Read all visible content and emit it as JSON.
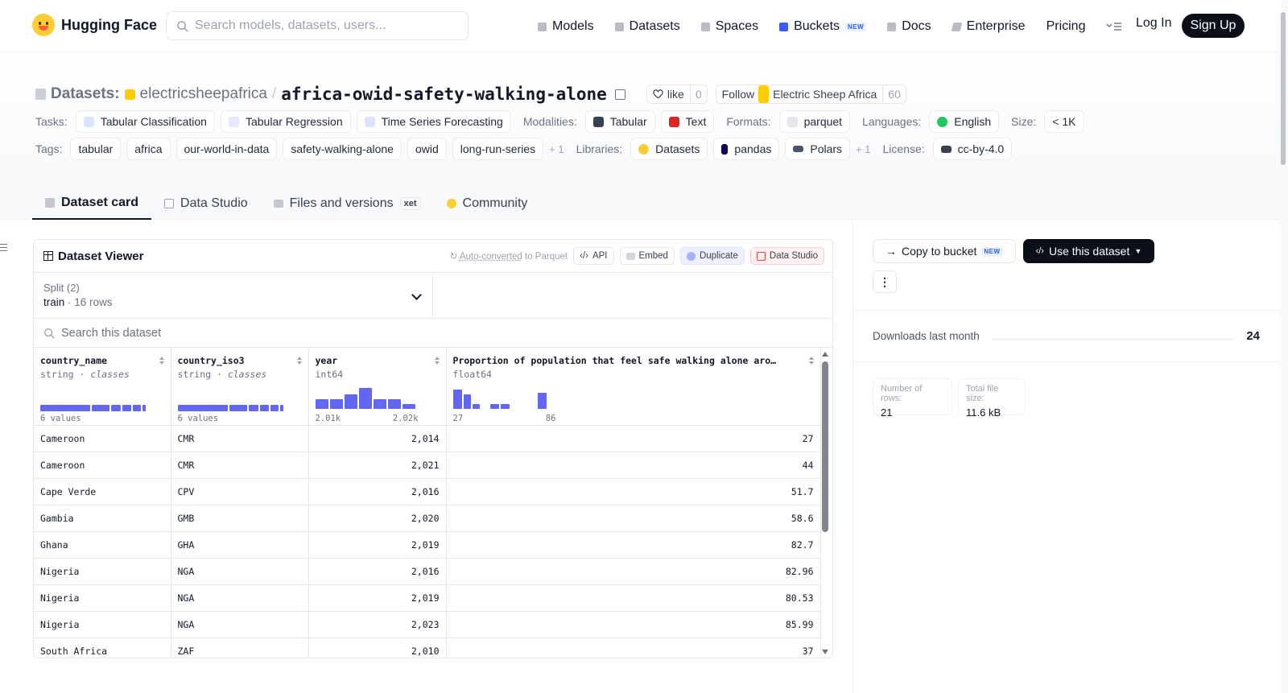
{
  "header": {
    "brand": "Hugging Face",
    "search_placeholder": "Search models, datasets, users...",
    "nav": [
      {
        "label": "Models",
        "icon": "cube-icon"
      },
      {
        "label": "Datasets",
        "icon": "database-icon"
      },
      {
        "label": "Spaces",
        "icon": "grid-icon"
      },
      {
        "label": "Buckets",
        "icon": "bucket-icon",
        "badge": "NEW"
      },
      {
        "label": "Docs",
        "icon": "book-icon"
      },
      {
        "label": "Enterprise",
        "icon": "enterprise-icon"
      },
      {
        "label": "Pricing"
      }
    ],
    "login": "Log In",
    "signup": "Sign Up"
  },
  "repo": {
    "type_label": "Datasets:",
    "owner": "electricsheepafrica",
    "name": "africa-owid-safety-walking-alone",
    "like_label": "like",
    "like_count": "0",
    "follow_label": "Follow",
    "follow_org": "Electric Sheep Africa",
    "follow_count": "60"
  },
  "meta": {
    "tasks_label": "Tasks:",
    "tasks": [
      "Tabular Classification",
      "Tabular Regression",
      "Time Series Forecasting"
    ],
    "modalities_label": "Modalities:",
    "modalities": [
      "Tabular",
      "Text"
    ],
    "formats_label": "Formats:",
    "formats": [
      "parquet"
    ],
    "languages_label": "Languages:",
    "languages": [
      "English"
    ],
    "size_label": "Size:",
    "size": "< 1K",
    "tags_label": "Tags:",
    "tags": [
      "tabular",
      "africa",
      "our-world-in-data",
      "safety-walking-alone",
      "owid",
      "long-run-series"
    ],
    "tags_more": "+ 1",
    "libraries_label": "Libraries:",
    "libraries": [
      "Datasets",
      "pandas",
      "Polars"
    ],
    "libraries_more": "+ 1",
    "license_label": "License:",
    "license": "cc-by-4.0"
  },
  "tabs": [
    {
      "label": "Dataset card",
      "active": true
    },
    {
      "label": "Data Studio"
    },
    {
      "label": "Files and versions",
      "badge": "xet"
    },
    {
      "label": "Community"
    }
  ],
  "viewer": {
    "title": "Dataset Viewer",
    "auto_converted": "Auto-converted",
    "auto_converted_suffix": "to Parquet",
    "api": "API",
    "embed": "Embed",
    "duplicate": "Duplicate",
    "data_studio": "Data Studio",
    "split_label": "Split (2)",
    "split_value": "train",
    "split_rows": "16 rows",
    "search_placeholder": "Search this dataset",
    "columns": [
      {
        "name": "country_name",
        "type": "string",
        "kind": "classes",
        "summary": "6 values"
      },
      {
        "name": "country_iso3",
        "type": "string",
        "kind": "classes",
        "summary": "6 values"
      },
      {
        "name": "year",
        "type": "int64",
        "min": "2.01k",
        "max": "2.02k"
      },
      {
        "name": "Proportion of population that feel safe walking alone aro…",
        "type": "float64",
        "min": "27",
        "max": "86"
      }
    ],
    "rows": [
      [
        "Cameroon",
        "CMR",
        "2,014",
        "27"
      ],
      [
        "Cameroon",
        "CMR",
        "2,021",
        "44"
      ],
      [
        "Cape Verde",
        "CPV",
        "2,016",
        "51.7"
      ],
      [
        "Gambia",
        "GMB",
        "2,020",
        "58.6"
      ],
      [
        "Ghana",
        "GHA",
        "2,019",
        "82.7"
      ],
      [
        "Nigeria",
        "NGA",
        "2,016",
        "82.96"
      ],
      [
        "Nigeria",
        "NGA",
        "2,019",
        "80.53"
      ],
      [
        "Nigeria",
        "NGA",
        "2,023",
        "85.99"
      ],
      [
        "South Africa",
        "ZAF",
        "2,010",
        "37"
      ]
    ]
  },
  "sidebar": {
    "copy_bucket": "Copy to bucket",
    "copy_badge": "NEW",
    "use_dataset": "Use this dataset",
    "downloads_label": "Downloads last month",
    "downloads_value": "24",
    "rows_label": "Number of rows:",
    "rows_value": "21",
    "filesize_label": "Total file size:",
    "filesize_value": "11.6 kB"
  },
  "colors": {
    "accent": "#6366f1",
    "dark": "#0b0f19"
  }
}
